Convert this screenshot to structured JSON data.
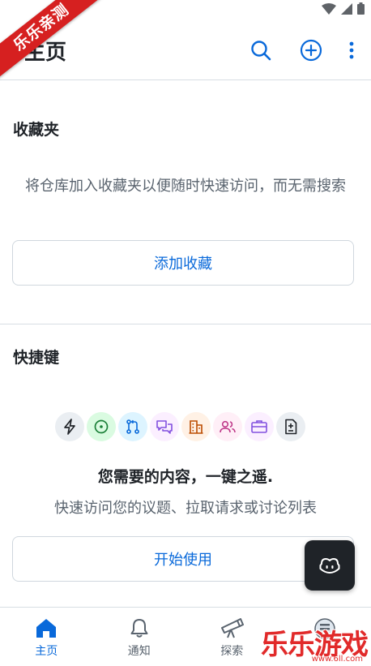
{
  "status_bar": {
    "icons": [
      "wifi-icon",
      "signal-icon",
      "battery-icon"
    ]
  },
  "ribbon": {
    "text": "乐乐亲测"
  },
  "header": {
    "title": "主页",
    "actions": [
      "search-icon",
      "add-circle-icon",
      "kebab-icon"
    ]
  },
  "favorites": {
    "title": "收藏夹",
    "description": "将仓库加入收藏夹以便随时快速访问，而无需搜索",
    "button_label": "添加收藏"
  },
  "shortcuts": {
    "title": "快捷键",
    "icons": [
      {
        "name": "zap-icon",
        "bg": "#eaeef2",
        "color": "#1f2328"
      },
      {
        "name": "issue-open-icon",
        "bg": "#dafbe1",
        "color": "#1a7f37"
      },
      {
        "name": "pull-request-icon",
        "bg": "#ddf4ff",
        "color": "#0969da"
      },
      {
        "name": "discussion-icon",
        "bg": "#fbefff",
        "color": "#8250df"
      },
      {
        "name": "organization-icon",
        "bg": "#fff1e5",
        "color": "#bc4c00"
      },
      {
        "name": "people-icon",
        "bg": "#ffeff7",
        "color": "#bf3989"
      },
      {
        "name": "briefcase-icon",
        "bg": "#fbefff",
        "color": "#8250df"
      },
      {
        "name": "diff-icon",
        "bg": "#eaeef2",
        "color": "#1f2328"
      }
    ],
    "heading": "您需要的内容，一键之遥.",
    "description": "快速访问您的议题、拉取请求或讨论列表",
    "button_label": "开始使用"
  },
  "copilot_button": {
    "icon": "copilot-icon"
  },
  "bottom_nav": {
    "items": [
      {
        "label": "主页",
        "icon": "home-icon",
        "active": true
      },
      {
        "label": "通知",
        "icon": "bell-icon",
        "active": false
      },
      {
        "label": "探索",
        "icon": "telescope-icon",
        "active": false
      },
      {
        "label": "",
        "icon": "profile-icon",
        "active": false
      }
    ]
  },
  "watermark": {
    "text": "乐乐游戏",
    "sub": "www.6ll.com"
  },
  "colors": {
    "accent": "#0969da",
    "text": "#1f2328",
    "muted": "#59636e",
    "border": "#d0d7de",
    "ribbon": "#d62020"
  }
}
